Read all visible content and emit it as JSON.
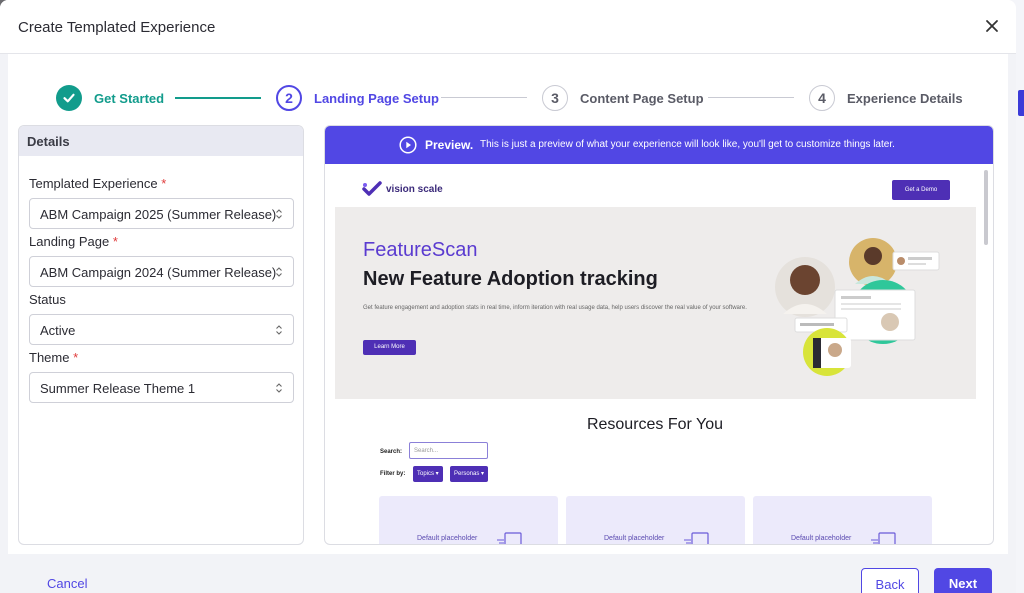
{
  "modal": {
    "title": "Create Templated Experience"
  },
  "stepper": {
    "steps": [
      {
        "label": "Get Started",
        "state": "done"
      },
      {
        "number": "2",
        "label": "Landing Page Setup",
        "state": "active"
      },
      {
        "number": "3",
        "label": "Content Page Setup",
        "state": "todo"
      },
      {
        "number": "4",
        "label": "Experience Details",
        "state": "todo"
      }
    ]
  },
  "details": {
    "heading": "Details",
    "fields": [
      {
        "label": "Templated Experience",
        "required": "*",
        "value": "ABM Campaign 2025 (Summer Release)"
      },
      {
        "label": "Landing Page",
        "required": "*",
        "value": "ABM Campaign 2024 (Summer Release)"
      },
      {
        "label": "Status",
        "value": "Active"
      },
      {
        "label": "Theme",
        "required": "*",
        "value": "Summer Release Theme 1"
      }
    ]
  },
  "preview": {
    "banner_strong": "Preview.",
    "banner_text": "This is just a preview of what your experience will look like, you'll get to customize things later.",
    "logo_text": "vision scale",
    "demo_button": "Get a Demo",
    "hero": {
      "eyebrow": "FeatureScan",
      "title": "New Feature Adoption tracking",
      "description": "Get feature engagement and adoption stats in real time, inform iteration with real usage data, help users discover the real value of your software.",
      "button": "Learn More"
    },
    "resources": {
      "title": "Resources For You",
      "search_label": "Search:",
      "search_placeholder": "Search...",
      "filter_label": "Filter by:",
      "chips": [
        "Topics ▾",
        "Personas ▾"
      ],
      "cards": [
        "Default placeholder image",
        "Default placeholder image",
        "Default placeholder image"
      ]
    }
  },
  "footer": {
    "cancel": "Cancel",
    "back": "Back",
    "next": "Next"
  },
  "colors": {
    "accent": "#5147e4",
    "success": "#129c8c",
    "preview_brand": "#4e2fb5"
  }
}
